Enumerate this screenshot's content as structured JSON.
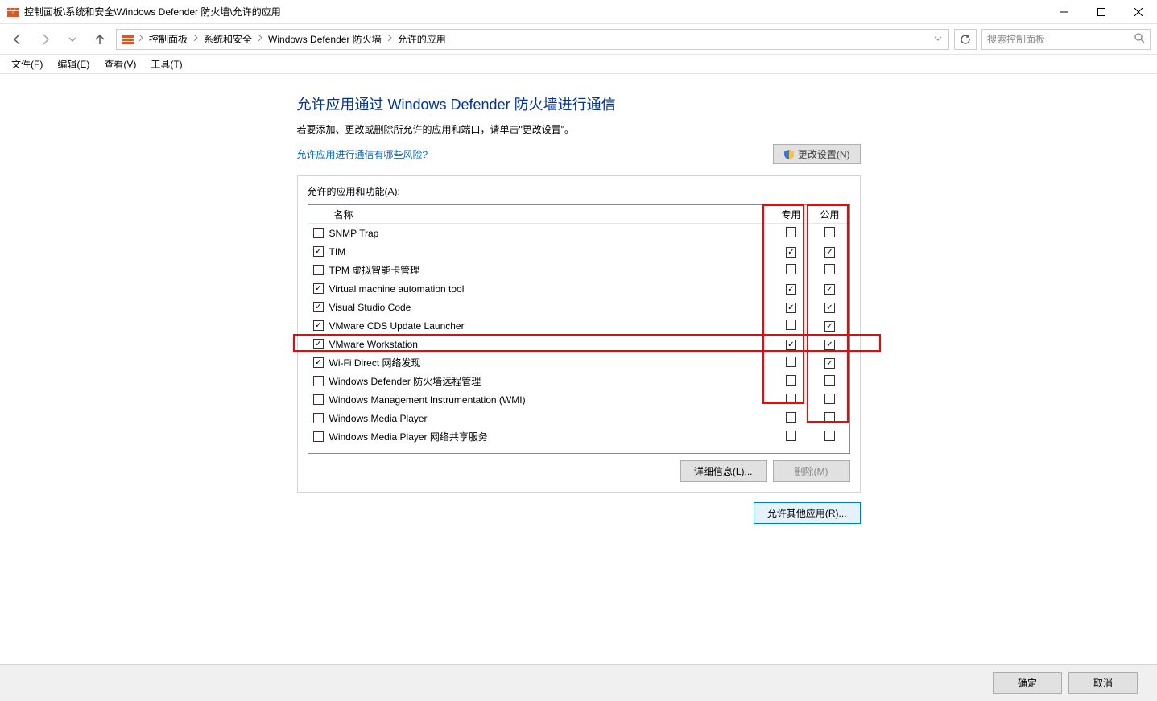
{
  "window": {
    "title": "控制面板\\系统和安全\\Windows Defender 防火墙\\允许的应用"
  },
  "breadcrumb": {
    "items": [
      "控制面板",
      "系统和安全",
      "Windows Defender 防火墙",
      "允许的应用"
    ]
  },
  "search": {
    "placeholder": "搜索控制面板"
  },
  "menubar": {
    "file": "文件(F)",
    "edit": "编辑(E)",
    "view": "查看(V)",
    "tools": "工具(T)"
  },
  "panel": {
    "title": "允许应用通过 Windows Defender 防火墙进行通信",
    "subtitle": "若要添加、更改或删除所允许的应用和端口，请单击\"更改设置\"。",
    "risk_link": "允许应用进行通信有哪些风险?",
    "change_settings": "更改设置(N)",
    "group_label": "允许的应用和功能(A):",
    "cols": {
      "name": "名称",
      "private": "专用",
      "public": "公用"
    },
    "rows": [
      {
        "enabled": false,
        "name": "SNMP Trap",
        "priv": false,
        "pub": false
      },
      {
        "enabled": true,
        "name": "TIM",
        "priv": true,
        "pub": true
      },
      {
        "enabled": false,
        "name": "TPM 虚拟智能卡管理",
        "priv": false,
        "pub": false
      },
      {
        "enabled": true,
        "name": "Virtual machine automation tool",
        "priv": true,
        "pub": true
      },
      {
        "enabled": true,
        "name": "Visual Studio Code",
        "priv": true,
        "pub": true
      },
      {
        "enabled": true,
        "name": "VMware CDS Update Launcher",
        "priv": false,
        "pub": true
      },
      {
        "enabled": true,
        "name": "VMware Workstation",
        "priv": true,
        "pub": true
      },
      {
        "enabled": true,
        "name": "Wi-Fi Direct 网络发现",
        "priv": false,
        "pub": true
      },
      {
        "enabled": false,
        "name": "Windows Defender 防火墙远程管理",
        "priv": false,
        "pub": false
      },
      {
        "enabled": false,
        "name": "Windows Management Instrumentation (WMI)",
        "priv": false,
        "pub": false
      },
      {
        "enabled": false,
        "name": "Windows Media Player",
        "priv": false,
        "pub": false
      },
      {
        "enabled": false,
        "name": "Windows Media Player 网络共享服务",
        "priv": false,
        "pub": false
      }
    ],
    "details": "详细信息(L)...",
    "remove": "删除(M)",
    "allow_other": "允许其他应用(R)..."
  },
  "bottom": {
    "ok": "确定",
    "cancel": "取消"
  }
}
